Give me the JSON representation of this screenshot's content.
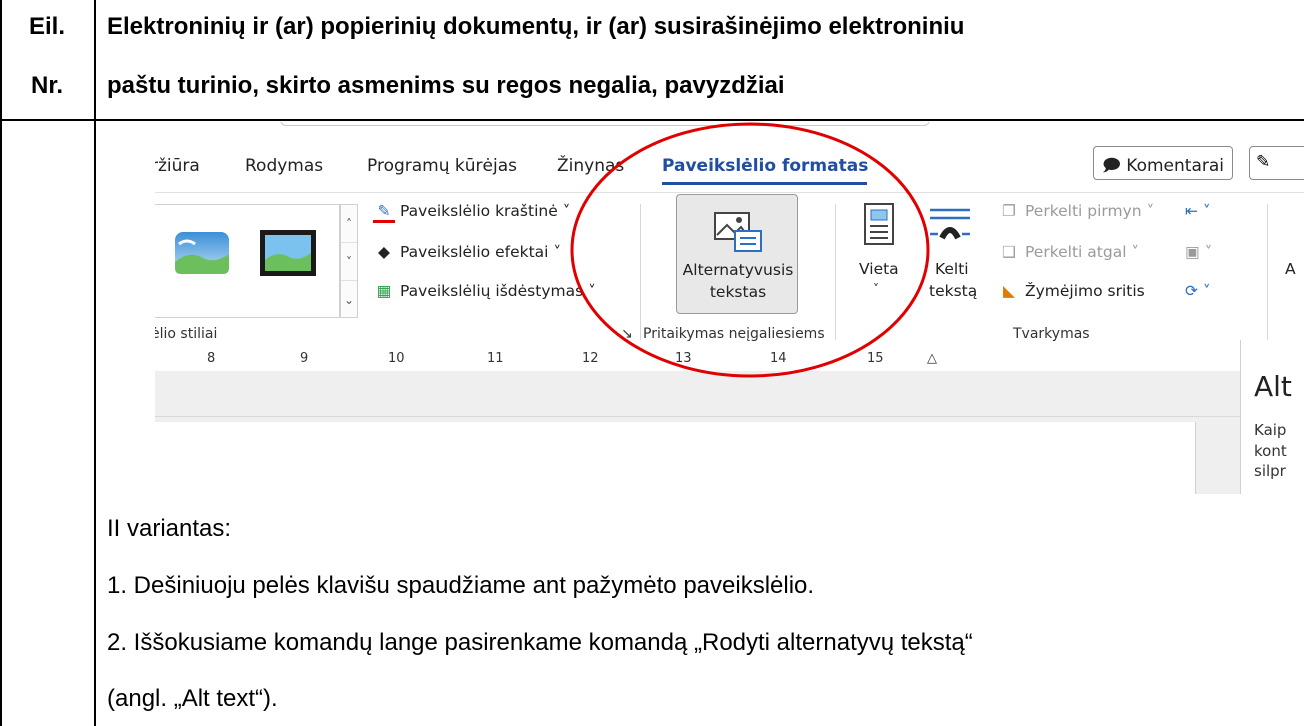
{
  "table": {
    "header_nr_line1": "Eil.",
    "header_nr_line2": "Nr.",
    "header_title_line1": "Elektroninių ir (ar) popierinių dokumentų, ir (ar) susirašinėjimo elektroniniu",
    "header_title_line2": "paštu turinio, skirto asmenims su regos negalia, pavyzdžiai"
  },
  "screenshot": {
    "tabs": [
      "ržiūra",
      "Rodymas",
      "Programų kūrėjas",
      "Žinynas"
    ],
    "active_tab": "Paveikslėlio formatas",
    "comments_button": "Komentarai",
    "style_commands": [
      "Paveikslėlio kraštinė",
      "Paveikslėlio efektai",
      "Paveikslėlių išdėstymas"
    ],
    "group_styles": "ėlio stiliai",
    "alt_text_line1": "Alternatyvusis",
    "alt_text_line2": "tekstas",
    "group_accessibility": "Pritaikymas neįgaliesiems",
    "position_label": "Vieta",
    "wrap_line1": "Kelti",
    "wrap_line2": "tekstą",
    "bring_forward": "Perkelti pirmyn",
    "send_backward": "Perkelti atgal",
    "selection_pane": "Žymėjimo sritis",
    "group_arrange": "Tvarkymas",
    "ruler_numbers": [
      "8",
      "9",
      "10",
      "11",
      "12",
      "13",
      "14",
      "15"
    ],
    "side_letter": "A",
    "pane_title": "Alt",
    "pane_lines": [
      "Kaip",
      "kont",
      "silpr"
    ],
    "highlight_color": "#e00000",
    "accent_color": "#1f4ea3"
  },
  "body": {
    "variant": "II variantas:",
    "step1": "1. Dešiniuoju pelės klavišu spaudžiame ant pažymėto paveikslėlio.",
    "step2": "2. Iššokusiame komandų lange pasirenkame komandą „Rodyti alternatyvų tekstą“",
    "step2_cont": "(angl. „Alt text“)."
  }
}
